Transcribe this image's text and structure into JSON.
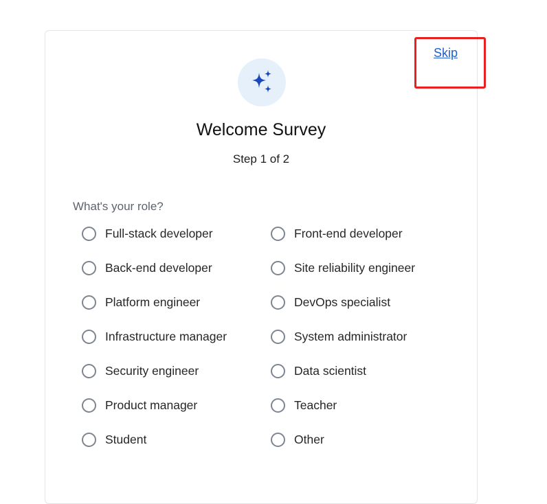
{
  "header": {
    "skip_label": "Skip",
    "title": "Welcome Survey",
    "step": "Step 1 of 2",
    "icon": "sparkles-icon"
  },
  "question": {
    "label": "What's your role?",
    "options": [
      "Full-stack developer",
      "Front-end developer",
      "Back-end developer",
      "Site reliability engineer",
      "Platform engineer",
      "DevOps specialist",
      "Infrastructure manager",
      "System administrator",
      "Security engineer",
      "Data scientist",
      "Product manager",
      "Teacher",
      "Student",
      "Other"
    ]
  },
  "colors": {
    "accent": "#1f5fd1",
    "icon_bg": "#e6f0fb",
    "icon": "#1b48b8",
    "highlight": "#e8201f"
  }
}
